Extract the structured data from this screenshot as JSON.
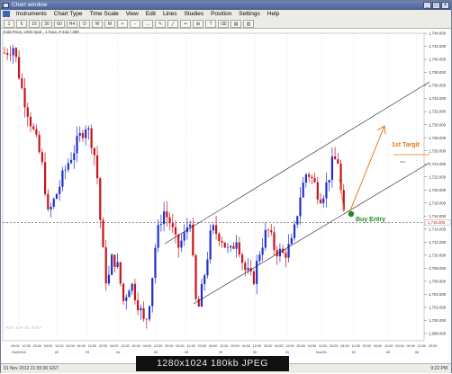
{
  "window": {
    "title": "Chart window"
  },
  "menu": [
    "Instruments",
    "Chart Type",
    "Time Scale",
    "View",
    "Edit",
    "Lines",
    "Studies",
    "Position",
    "Settings",
    "Help"
  ],
  "chart": {
    "info": "Gold Price, USD Spot , 1 hour, # 244 / 300",
    "watermark": "R O . G R I D . N E T",
    "price_labels": [
      "1,744.000",
      "1,742.000",
      "1,740.000",
      "1,738.000",
      "1,736.000",
      "1,734.000",
      "1,732.000",
      "1,730.000",
      "1,728.000",
      "1,726.000",
      "1,724.000",
      "1,722.000",
      "1,720.000",
      "1,718.000",
      "1,716.000",
      "1,714.000",
      "1,712.000",
      "1,710.000",
      "1,708.000",
      "1,706.000",
      "1,704.000",
      "1,702.000",
      "1,700.000",
      "1,698.000"
    ],
    "current_price": "1,715.000",
    "time_labels": [
      "04:00",
      "12:00",
      "20:00",
      "04:00",
      "12:00",
      "20:00",
      "04:00",
      "12:00",
      "20:00",
      "04:00",
      "12:00",
      "20:00",
      "04:00",
      "12:00",
      "20:00",
      "04:00",
      "12:00",
      "20:00",
      "04:00",
      "12:00",
      "20:00",
      "04:00",
      "12:00",
      "20:00",
      "04:00",
      "12:00",
      "20:00",
      "04:00",
      "12:00",
      "20:00",
      "04:00",
      "12:00",
      "20:00",
      "04:00",
      "12:00",
      "20:00",
      "04:00",
      "12:00",
      "20:00"
    ],
    "date_labels": [
      "Oct/19/12",
      "22",
      "23",
      "24",
      "25",
      "26",
      "29",
      "30",
      "31",
      "Nov/01",
      "02",
      "05",
      "06"
    ],
    "annotations": {
      "target": "1st Targit",
      "entry": "Buy Entry",
      "target_small": "xxx"
    },
    "colors": {
      "bull": "#1f2fd0",
      "bear": "#c8141c",
      "channel": "#222222",
      "arrow": "#e07a1c",
      "entry": "#1f8a1f"
    }
  },
  "status": {
    "datetime": "01 Nov 2012 21:55:36 GST",
    "clock": "9:22 PM"
  },
  "caption": "1280x1024  180kb  JPEG"
}
